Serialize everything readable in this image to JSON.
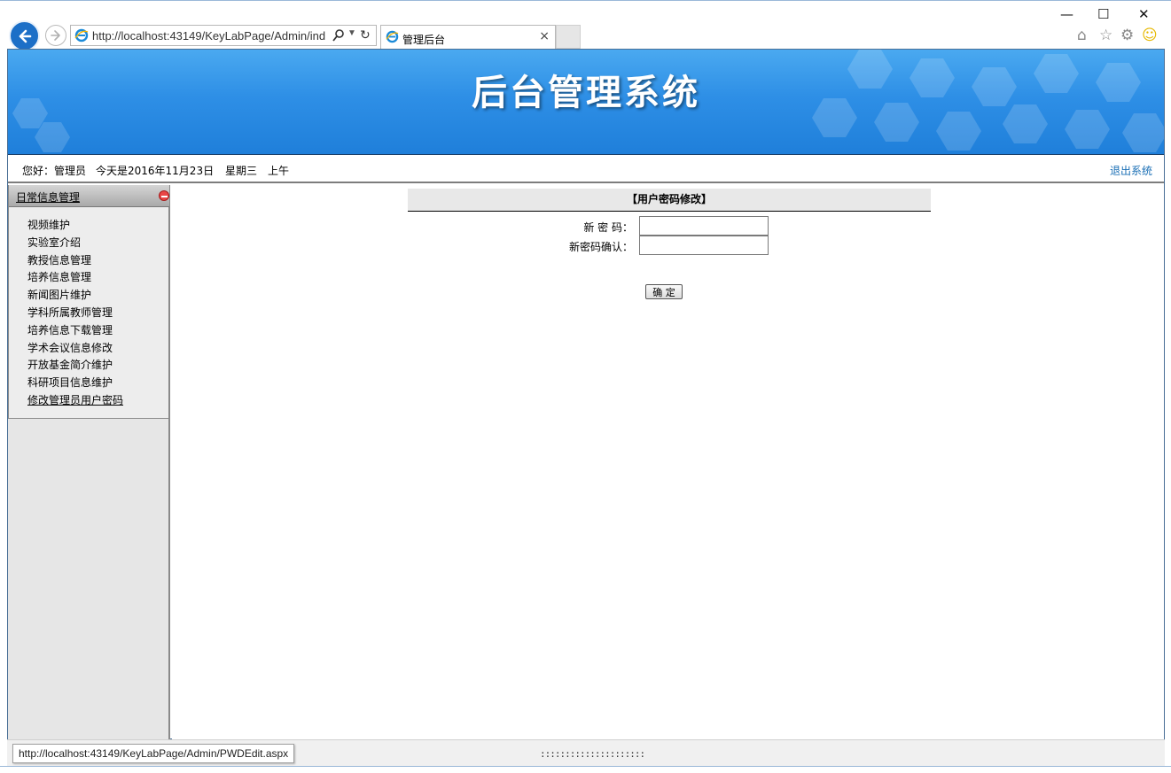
{
  "browser": {
    "url": "http://localhost:43149/KeyLabPage/Admin/ind",
    "tab_title": "管理后台",
    "status_url": "http://localhost:43149/KeyLabPage/Admin/PWDEdit.aspx",
    "status_dots": ":::::::::::::::::::::",
    "icons": [
      "back-arrow-icon",
      "forward-arrow-icon",
      "ie-icon",
      "search-icon",
      "dropdown-icon",
      "refresh-icon",
      "close-icon",
      "minimize-icon",
      "maximize-icon",
      "home-icon",
      "star-icon",
      "gear-icon",
      "smiley-icon"
    ]
  },
  "banner": {
    "title": "后台管理系统"
  },
  "infobar": {
    "greeting": "您好：管理员",
    "date": "今天是2016年11月23日",
    "weekday": "星期三",
    "ampm": "上午",
    "logout": "退出系统"
  },
  "sidebar": {
    "header": "日常信息管理",
    "items": [
      {
        "label": "视频维护"
      },
      {
        "label": "实验室介绍"
      },
      {
        "label": "教授信息管理"
      },
      {
        "label": "培养信息管理"
      },
      {
        "label": "新闻图片维护"
      },
      {
        "label": "学科所属教师管理"
      },
      {
        "label": "培养信息下载管理"
      },
      {
        "label": "学术会议信息修改"
      },
      {
        "label": "开放基金简介维护"
      },
      {
        "label": "科研项目信息维护"
      },
      {
        "label": "修改管理员用户密码"
      }
    ]
  },
  "form": {
    "title": "【用户密码修改】",
    "new_password_label": "新 密 码：",
    "new_password_value": "",
    "confirm_label": "新密码确认：",
    "confirm_value": "",
    "submit_label": "确 定"
  },
  "colors": {
    "banner": "#2e8fe6",
    "link": "#1a6fb5",
    "sidebar_bg": "#e6e6e6",
    "form_header_bg": "#e8e8e8"
  }
}
